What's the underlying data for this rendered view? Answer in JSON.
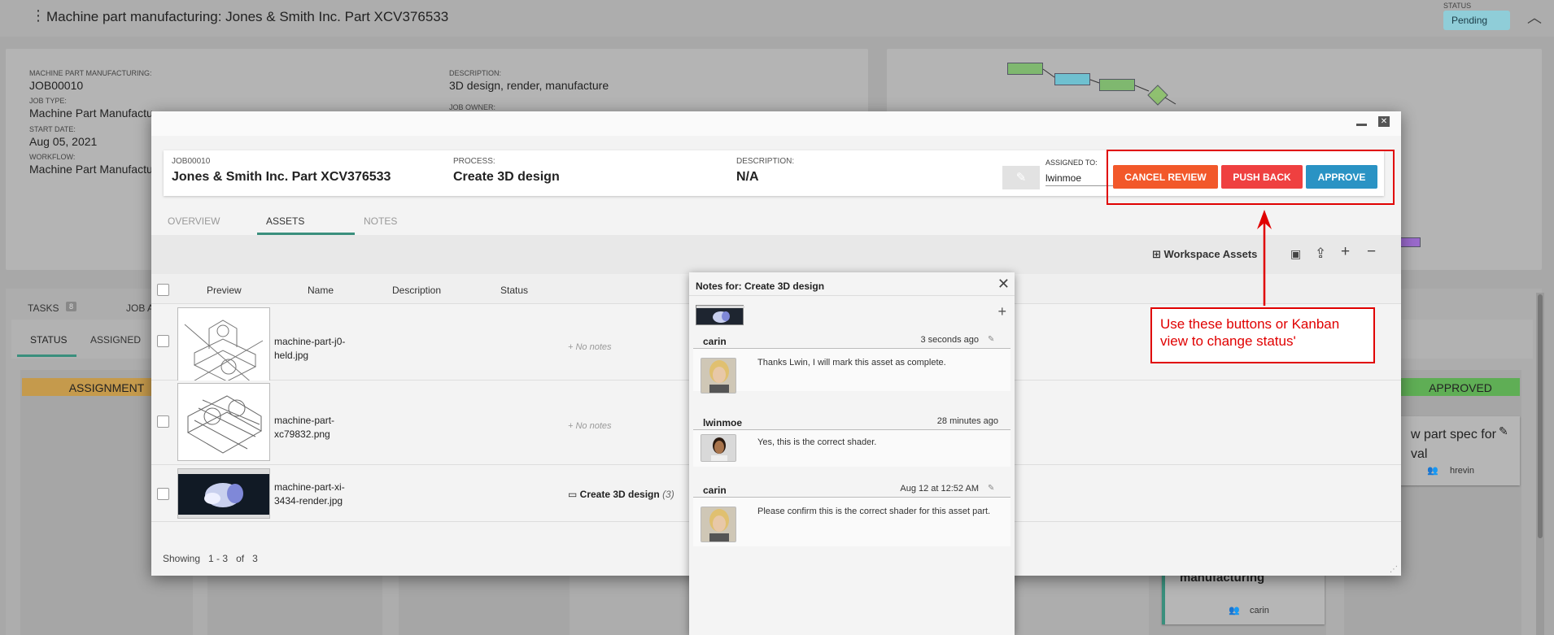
{
  "app": {
    "title": "Machine part manufacturing: Jones & Smith Inc. Part XCV376533",
    "status_label": "STATUS",
    "status": "Pending"
  },
  "info": {
    "mpm_label": "MACHINE PART MANUFACTURING:",
    "mpm_value": "JOB00010",
    "jobtype_label": "JOB TYPE:",
    "jobtype_value": "Machine Part Manufactu",
    "start_label": "START DATE:",
    "start_value": "Aug 05, 2021",
    "workflow_label": "WORKFLOW:",
    "workflow_value": "Machine Part Manufactu",
    "desc_label": "DESCRIPTION:",
    "desc_value": "3D design, render, manufacture",
    "owner_label": "JOB OWNER:"
  },
  "board": {
    "tabs": [
      "TASKS",
      "JOB A"
    ],
    "tasks_count": "8",
    "subtabs": [
      "STATUS",
      "ASSIGNED"
    ],
    "columns": [
      {
        "name": "ASSIGNMENT",
        "color": "#d9a850"
      },
      {
        "name": "APPROVED",
        "color": "#6fbf63"
      }
    ],
    "cards": [
      {
        "title": "w part spec for\nval",
        "user": "hrevin"
      },
      {
        "title": "manufacturing",
        "user": "carin"
      }
    ]
  },
  "task": {
    "job_id": "JOB00010",
    "name": "Jones & Smith Inc. Part XCV376533",
    "process_label": "PROCESS:",
    "process": "Create 3D design",
    "desc_label": "DESCRIPTION:",
    "desc": "N/A",
    "assigned_label": "ASSIGNED TO:",
    "assigned": "lwinmoe"
  },
  "actions": {
    "cancel": "CANCEL REVIEW",
    "pushback": "PUSH BACK",
    "approve": "APPROVE",
    "colors": {
      "cancel": "#f2582a",
      "pushback": "#ef4040",
      "approve": "#2a93c4"
    }
  },
  "tabs": {
    "overview": "OVERVIEW",
    "assets": "ASSETS",
    "notes": "NOTES"
  },
  "toolbar": {
    "workspace": "Workspace Assets"
  },
  "grid": {
    "headers": [
      "Preview",
      "Name",
      "Description",
      "Status"
    ],
    "rows": [
      {
        "name": "machine-part-j0-held.jpg",
        "notes": "No notes"
      },
      {
        "name": "machine-part-xc79832.png",
        "notes": "No notes"
      },
      {
        "name": "machine-part-xi-3434-render.jpg",
        "process": "Create 3D design",
        "count": "(3)"
      }
    ]
  },
  "footer": {
    "showing": "Showing",
    "range": "1 - 3",
    "of": "of",
    "total": "3"
  },
  "notes": {
    "title": "Notes for: Create 3D design",
    "items": [
      {
        "author": "carin",
        "time": "3 seconds ago",
        "text": "Thanks Lwin, I will mark this asset as complete."
      },
      {
        "author": "lwinmoe",
        "time": "28 minutes ago",
        "text": "Yes, this is the correct shader."
      },
      {
        "author": "carin",
        "time": "Aug 12 at 12:52 AM",
        "text": "Please confirm this is the correct shader for this asset part."
      }
    ]
  },
  "annotation": {
    "text": "Use these buttons or Kanban view to change status'"
  }
}
